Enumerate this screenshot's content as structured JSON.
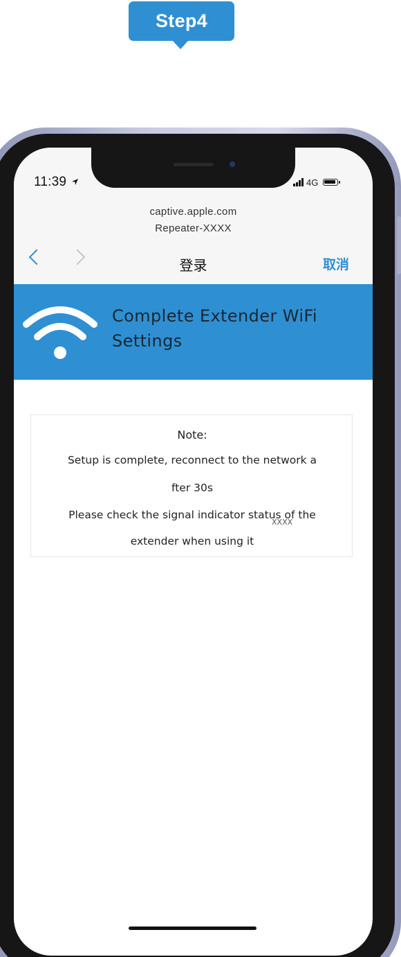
{
  "step": {
    "label": "Step4"
  },
  "status_bar": {
    "time": "11:39",
    "network": "4G"
  },
  "browser": {
    "url_line1": "captive.apple.com",
    "url_line2": "Repeater-XXXX",
    "title": "登录",
    "cancel_label": "取消"
  },
  "banner": {
    "title": "Complete Extender WiFi Settings",
    "icon": "wifi-icon"
  },
  "note": {
    "title": "Note:",
    "line1": "Setup is complete, reconnect to the network a",
    "line2": "fter 30s",
    "line3": "Please check the signal indicator status of the",
    "line4": "extender when using it",
    "watermark": "XXXX"
  },
  "colors": {
    "accent": "#2f8fd3",
    "chrome_bg": "#f6f6f7",
    "frame": "#161616"
  }
}
